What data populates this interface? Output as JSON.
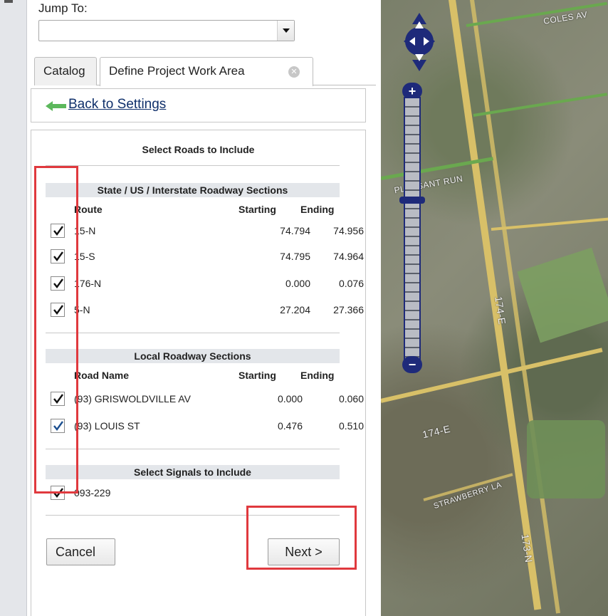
{
  "jump_to": {
    "label": "Jump To:",
    "selected": ""
  },
  "tabs": [
    {
      "label": "Catalog"
    },
    {
      "label": "Define Project Work Area"
    }
  ],
  "back_link": {
    "label": "Back to Settings"
  },
  "roads_header": "Select Roads to Include",
  "state_section": {
    "title": "State / US / Interstate Roadway Sections",
    "columns": {
      "name": "Route",
      "start": "Starting",
      "end": "Ending"
    },
    "rows": [
      {
        "name": "15-N",
        "start": "74.794",
        "end": "74.956",
        "checked": true
      },
      {
        "name": "15-S",
        "start": "74.795",
        "end": "74.964",
        "checked": true
      },
      {
        "name": "176-N",
        "start": "0.000",
        "end": "0.076",
        "checked": true
      },
      {
        "name": "5-N",
        "start": "27.204",
        "end": "27.366",
        "checked": true
      }
    ]
  },
  "local_section": {
    "title": "Local Roadway Sections",
    "columns": {
      "name": "Road Name",
      "start": "Starting",
      "end": "Ending"
    },
    "rows": [
      {
        "name": "(93) GRISWOLDVILLE AV",
        "start": "0.000",
        "end": "0.060",
        "checked": true
      },
      {
        "name": "(93) LOUIS ST",
        "start": "0.476",
        "end": "0.510",
        "checked": true
      }
    ]
  },
  "signals_section": {
    "title": "Select Signals to Include",
    "rows": [
      {
        "name": "093-229",
        "checked": true
      }
    ]
  },
  "buttons": {
    "cancel": "Cancel",
    "next": "Next >"
  },
  "map": {
    "labels": {
      "coles": "COLES AV",
      "pleasant": "PLEASANT RUN",
      "e174_upper": "174-E",
      "e174_lower": "174-E",
      "strawberry": "STRAWBERRY LA",
      "n173": "173-N"
    }
  },
  "colors": {
    "highlight": "#e0393e",
    "nav": "#1e2a7a",
    "link": "#10306b"
  }
}
